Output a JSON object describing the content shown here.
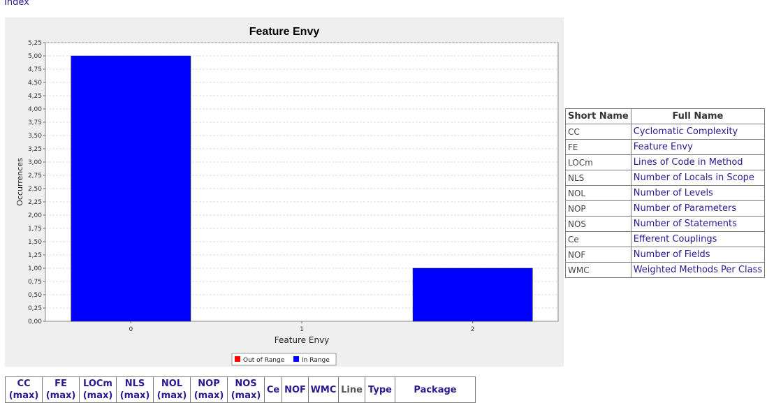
{
  "nav": {
    "index_link": "Index"
  },
  "chart_data": {
    "type": "bar",
    "title": "Feature Envy",
    "xlabel": "Feature Envy",
    "ylabel": "Occurrences",
    "categories": [
      "0",
      "1",
      "2"
    ],
    "series": [
      {
        "name": "Out of Range",
        "color": "#ff0000",
        "values": [
          0,
          0,
          0
        ]
      },
      {
        "name": "In Range",
        "color": "#0000ff",
        "values": [
          5,
          0,
          1
        ]
      }
    ],
    "ylim": [
      0,
      5.25
    ],
    "yticks": [
      "0,00",
      "0,25",
      "0,50",
      "0,75",
      "1,00",
      "1,25",
      "1,50",
      "1,75",
      "2,00",
      "2,25",
      "2,50",
      "2,75",
      "3,00",
      "3,25",
      "3,50",
      "3,75",
      "4,00",
      "4,25",
      "4,50",
      "4,75",
      "5,00",
      "5,25"
    ],
    "grid": true,
    "legend_position": "bottom-center"
  },
  "legend_table": {
    "headers": {
      "short": "Short Name",
      "full": "Full Name"
    },
    "rows": [
      {
        "short": "CC",
        "full": "Cyclomatic Complexity"
      },
      {
        "short": "FE",
        "full": "Feature Envy"
      },
      {
        "short": "LOCm",
        "full": "Lines of Code in Method"
      },
      {
        "short": "NLS",
        "full": "Number of Locals in Scope"
      },
      {
        "short": "NOL",
        "full": "Number of Levels"
      },
      {
        "short": "NOP",
        "full": "Number of Parameters"
      },
      {
        "short": "NOS",
        "full": "Number of Statements"
      },
      {
        "short": "Ce",
        "full": "Efferent Couplings"
      },
      {
        "short": "NOF",
        "full": "Number of Fields"
      },
      {
        "short": "WMC",
        "full": "Weighted Methods Per Class"
      }
    ]
  },
  "metrics_table": {
    "headers": [
      {
        "label": "CC",
        "sub": "(max)",
        "muted": false
      },
      {
        "label": "FE",
        "sub": "(max)",
        "muted": false
      },
      {
        "label": "LOCm",
        "sub": "(max)",
        "muted": false
      },
      {
        "label": "NLS",
        "sub": "(max)",
        "muted": false
      },
      {
        "label": "NOL",
        "sub": "(max)",
        "muted": false
      },
      {
        "label": "NOP",
        "sub": "(max)",
        "muted": false
      },
      {
        "label": "NOS",
        "sub": "(max)",
        "muted": false
      },
      {
        "label": "Ce",
        "sub": "",
        "muted": false
      },
      {
        "label": "NOF",
        "sub": "",
        "muted": false
      },
      {
        "label": "WMC",
        "sub": "",
        "muted": false
      },
      {
        "label": "Line",
        "sub": "",
        "muted": true
      },
      {
        "label": "Type",
        "sub": "",
        "muted": false
      },
      {
        "label": "Package",
        "sub": "",
        "muted": false
      }
    ]
  }
}
